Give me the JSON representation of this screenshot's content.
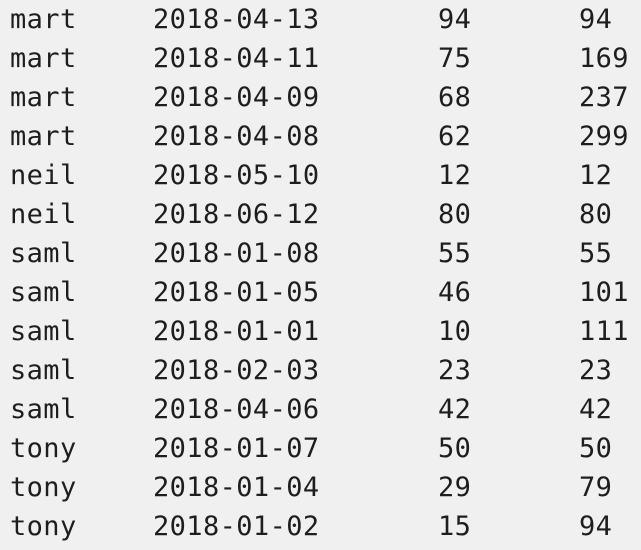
{
  "output": {
    "rows": [
      {
        "name": "mart",
        "date": "2018-04-13",
        "amount": "94",
        "cumulative": "94"
      },
      {
        "name": "mart",
        "date": "2018-04-11",
        "amount": "75",
        "cumulative": "169"
      },
      {
        "name": "mart",
        "date": "2018-04-09",
        "amount": "68",
        "cumulative": "237"
      },
      {
        "name": "mart",
        "date": "2018-04-08",
        "amount": "62",
        "cumulative": "299"
      },
      {
        "name": "neil",
        "date": "2018-05-10",
        "amount": "12",
        "cumulative": "12"
      },
      {
        "name": "neil",
        "date": "2018-06-12",
        "amount": "80",
        "cumulative": "80"
      },
      {
        "name": "saml",
        "date": "2018-01-08",
        "amount": "55",
        "cumulative": "55"
      },
      {
        "name": "saml",
        "date": "2018-01-05",
        "amount": "46",
        "cumulative": "101"
      },
      {
        "name": "saml",
        "date": "2018-01-01",
        "amount": "10",
        "cumulative": "111"
      },
      {
        "name": "saml",
        "date": "2018-02-03",
        "amount": "23",
        "cumulative": "23"
      },
      {
        "name": "saml",
        "date": "2018-04-06",
        "amount": "42",
        "cumulative": "42"
      },
      {
        "name": "tony",
        "date": "2018-01-07",
        "amount": "50",
        "cumulative": "50"
      },
      {
        "name": "tony",
        "date": "2018-01-04",
        "amount": "29",
        "cumulative": "79"
      },
      {
        "name": "tony",
        "date": "2018-01-02",
        "amount": "15",
        "cumulative": "94"
      }
    ]
  }
}
